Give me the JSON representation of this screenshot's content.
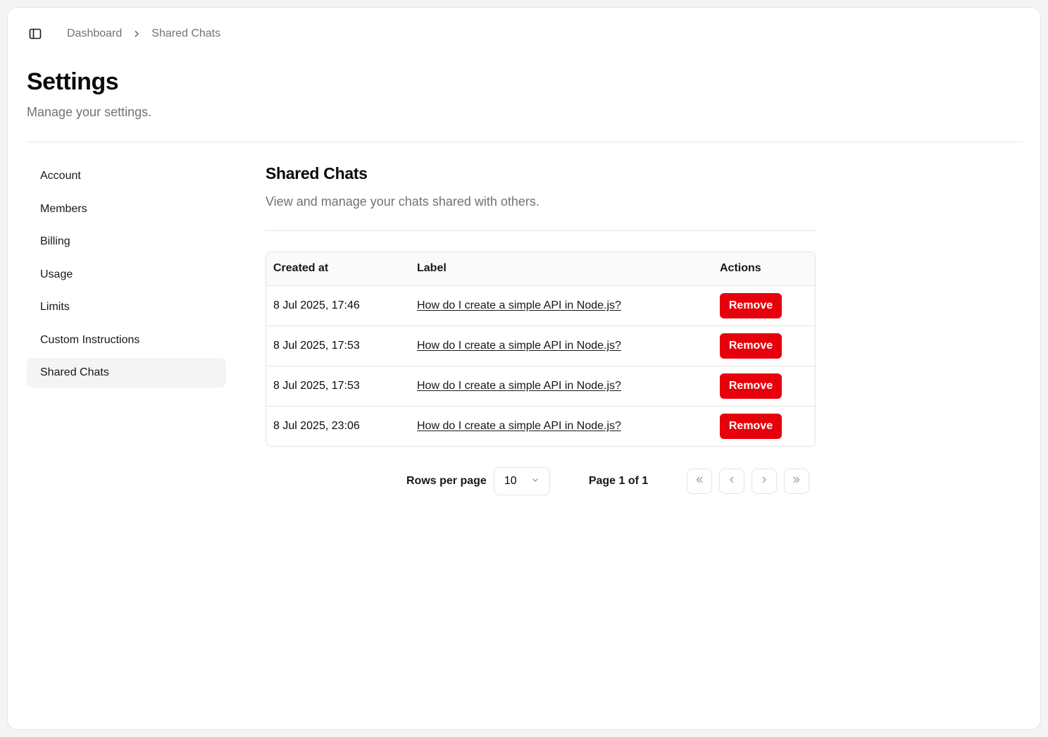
{
  "breadcrumb": {
    "items": [
      "Dashboard",
      "Shared Chats"
    ]
  },
  "header": {
    "title": "Settings",
    "subtitle": "Manage your settings."
  },
  "sidebar": {
    "items": [
      {
        "label": "Account",
        "active": false
      },
      {
        "label": "Members",
        "active": false
      },
      {
        "label": "Billing",
        "active": false
      },
      {
        "label": "Usage",
        "active": false
      },
      {
        "label": "Limits",
        "active": false
      },
      {
        "label": "Custom Instructions",
        "active": false
      },
      {
        "label": "Shared Chats",
        "active": true
      }
    ]
  },
  "section": {
    "title": "Shared Chats",
    "description": "View and manage your chats shared with others."
  },
  "table": {
    "headers": [
      "Created at",
      "Label",
      "Actions"
    ],
    "rows": [
      {
        "created_at": "8 Jul 2025, 17:46",
        "label": "How do I create a simple API in Node.js?",
        "action": "Remove"
      },
      {
        "created_at": "8 Jul 2025, 17:53",
        "label": "How do I create a simple API in Node.js?",
        "action": "Remove"
      },
      {
        "created_at": "8 Jul 2025, 17:53",
        "label": "How do I create a simple API in Node.js?",
        "action": "Remove"
      },
      {
        "created_at": "8 Jul 2025, 23:06",
        "label": "How do I create a simple API in Node.js?",
        "action": "Remove"
      }
    ]
  },
  "pagination": {
    "rows_per_page_label": "Rows per page",
    "rows_per_page_value": "10",
    "page_info": "Page 1 of 1"
  },
  "colors": {
    "danger": "#e7000b",
    "muted_text": "#71717a",
    "border": "#e4e4e7",
    "active_bg": "#f4f4f5"
  },
  "icons": [
    "sidebar-toggle-icon",
    "chevron-right-icon",
    "chevron-down-icon",
    "chevrons-left-icon",
    "chevron-left-icon",
    "chevron-right-icon",
    "chevrons-right-icon"
  ]
}
